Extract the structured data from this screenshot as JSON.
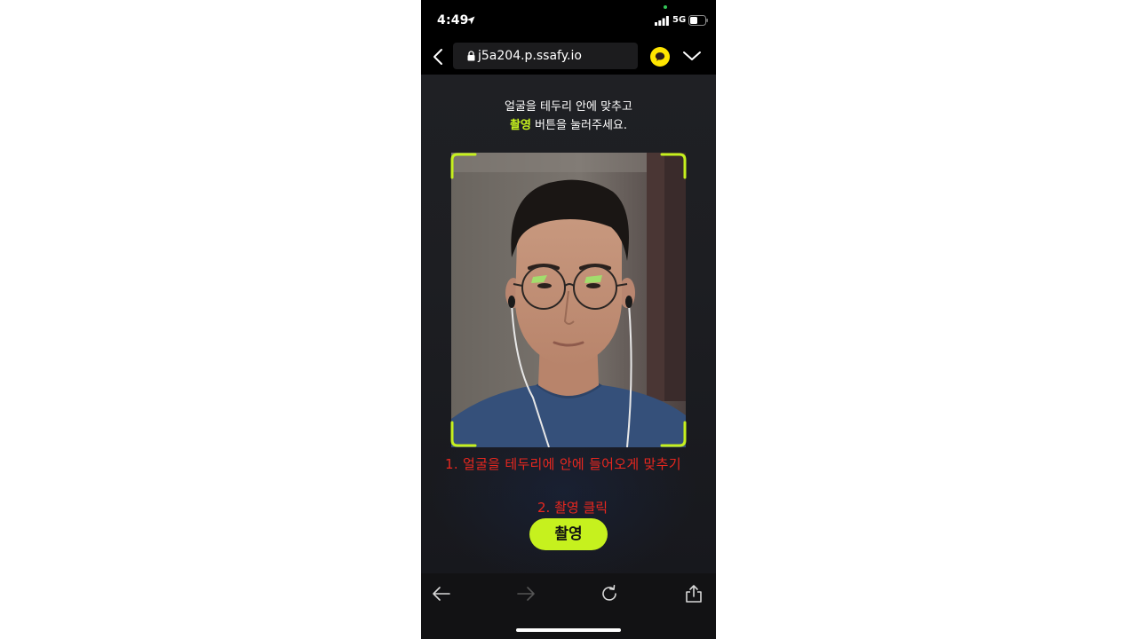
{
  "status_bar": {
    "time": "4:49",
    "network": "5G",
    "icons": [
      "location-arrow-icon",
      "camera-in-use-dot",
      "signal-icon",
      "battery-icon"
    ]
  },
  "browser": {
    "url": "j5a204.p.ssafy.io",
    "icons": [
      "back-chevron-icon",
      "lock-icon",
      "kakaotalk-icon",
      "menu-chevron-icon"
    ]
  },
  "page": {
    "instruction_line1": "얼굴을 테두리 안에 맞추고",
    "instruction_highlight": "촬영",
    "instruction_line2_rest": " 버튼을 눌러주세요.",
    "capture_button_label": "촬영"
  },
  "annotations": {
    "step1": "1. 얼굴을 테두리에 안에 들어오게 맞추기",
    "step2": "2. 촬영 클릭"
  },
  "toolbar": {
    "icons": [
      "arrow-left-icon",
      "arrow-right-icon",
      "reload-icon",
      "share-icon"
    ]
  },
  "colors": {
    "accent": "#c6f11e",
    "annotation": "#e8271f",
    "page_bg": "#1c1d21",
    "toolbar_bg": "#121214"
  }
}
